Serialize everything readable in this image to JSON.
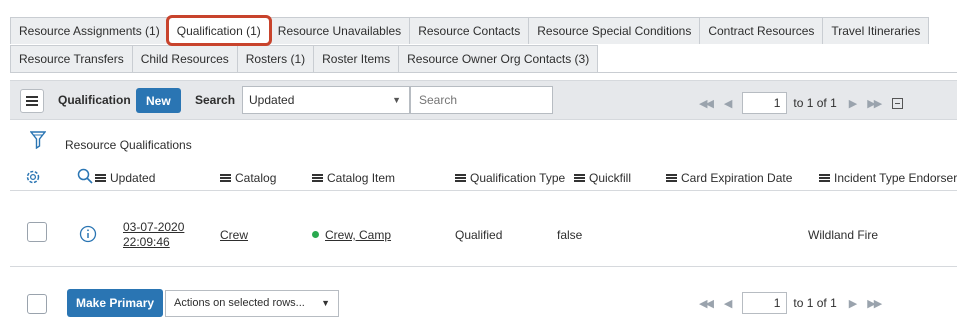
{
  "tabs_row1": [
    "Resource Assignments (1)",
    "Qualification (1)",
    "Resource Unavailables",
    "Resource Contacts",
    "Resource Special Conditions",
    "Contract Resources",
    "Travel Itineraries"
  ],
  "tabs_row2": [
    "Resource Transfers",
    "Child Resources",
    "Rosters (1)",
    "Roster Items",
    "Resource Owner Org Contacts (3)"
  ],
  "toolbar": {
    "title": "Qualification",
    "new_label": "New",
    "search_label": "Search",
    "search_field": "Updated",
    "search_placeholder": "Search",
    "page": "1",
    "page_range": "to 1 of 1"
  },
  "list": {
    "title": "Resource Qualifications",
    "columns": [
      "Updated",
      "Catalog",
      "Catalog Item",
      "Qualification Type",
      "Quickfill",
      "Card Expiration Date",
      "Incident Type Endorser"
    ],
    "rows": [
      {
        "updated_date": "03-07-2020",
        "updated_time": "22:09:46",
        "catalog": "Crew",
        "catalog_item": "Crew, Camp",
        "qualification_type": "Qualified",
        "quickfill": "false",
        "card_expiration_date": "",
        "incident_type_endorser": "Wildland Fire"
      }
    ]
  },
  "footer": {
    "make_primary_label": "Make Primary",
    "actions_label": "Actions on selected rows...",
    "page": "1",
    "page_range": "to 1 of 1"
  },
  "colors": {
    "button_blue": "#2a75b3",
    "highlight_red": "#c8432c",
    "status_green": "#2aa94f",
    "toolbar_gray": "#e6e8eb"
  },
  "icons": [
    "hamburger-icon",
    "filter-icon",
    "gear-icon",
    "search-icon",
    "info-icon",
    "first-page-icon",
    "prev-page-icon",
    "next-page-icon",
    "last-page-icon",
    "collapse-icon",
    "caret-down-icon"
  ]
}
